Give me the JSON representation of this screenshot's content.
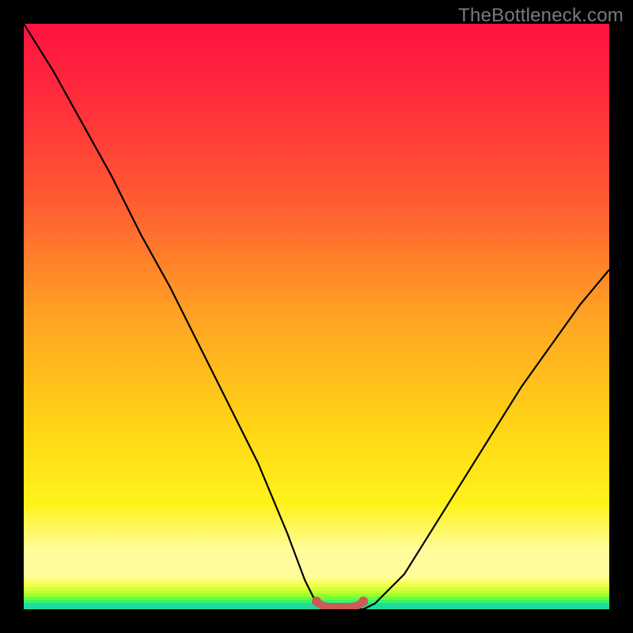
{
  "watermark": "TheBottleneck.com",
  "chart_data": {
    "type": "line",
    "title": "",
    "xlabel": "",
    "ylabel": "",
    "xlim": [
      0,
      100
    ],
    "ylim": [
      0,
      100
    ],
    "grid": false,
    "legend": false,
    "x": [
      0,
      5,
      10,
      15,
      20,
      25,
      30,
      35,
      40,
      45,
      48,
      50,
      52,
      55,
      58,
      60,
      65,
      70,
      75,
      80,
      85,
      90,
      95,
      100
    ],
    "values": [
      100,
      92,
      83,
      74,
      64,
      55,
      45,
      35,
      25,
      13,
      5,
      1,
      0,
      0,
      0,
      1,
      6,
      14,
      22,
      30,
      38,
      45,
      52,
      58
    ],
    "trough": {
      "x_range": [
        50,
        58
      ],
      "y": 0
    },
    "stripe_colors": [
      "#ffff80",
      "#f6ff60",
      "#ecff4a",
      "#daff3a",
      "#c4ff30",
      "#9cff2c",
      "#6cff3a",
      "#3af56c",
      "#20e090",
      "#1fd8a4"
    ],
    "trough_marker_color": "#cc5a56",
    "curve_color": "#000000"
  }
}
